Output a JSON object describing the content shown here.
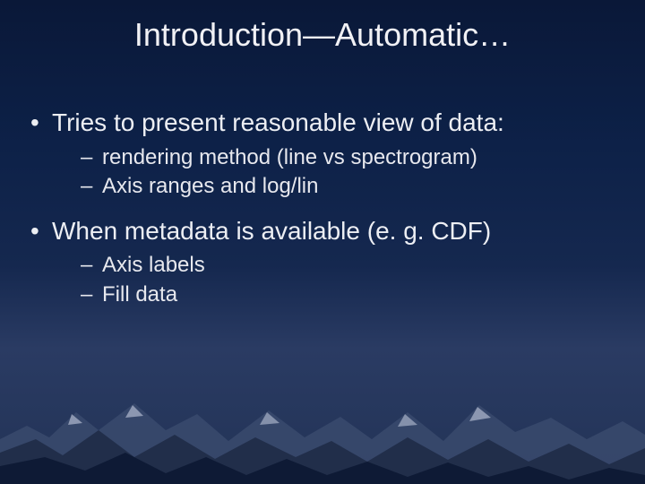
{
  "title": "Introduction—Automatic…",
  "bullets": [
    {
      "text": "Tries to present reasonable view of data:",
      "sub": [
        "rendering method (line vs spectrogram)",
        "Axis ranges and log/lin"
      ]
    },
    {
      "text": "When metadata is available (e. g. CDF)",
      "sub": [
        "Axis labels",
        "Fill data"
      ]
    }
  ]
}
